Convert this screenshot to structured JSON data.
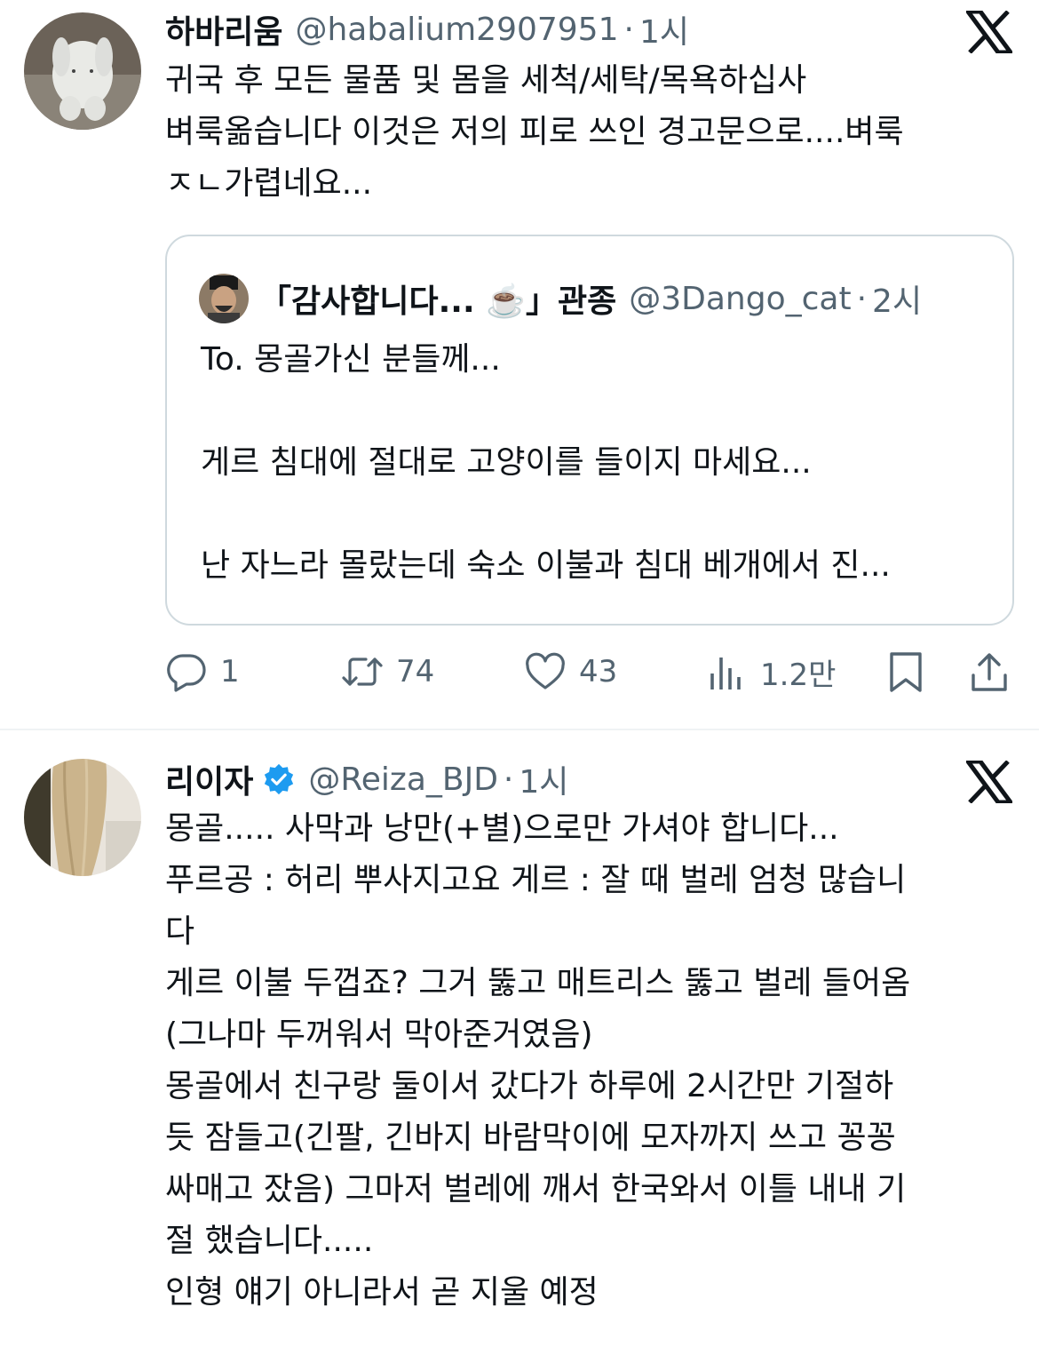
{
  "tweets": [
    {
      "display_name": "하바리움",
      "handle": "@habalium2907951",
      "separator": "·",
      "time": "1시",
      "lines": [
        "귀국 후 모든 물품 및 몸을 세척/세탁/목욕하십사",
        "벼룩옮습니다 이것은 저의 피로 쓰인 경고문으로....벼룩",
        "ㅈㄴ가렵네요..."
      ],
      "quote": {
        "display_name": "「감사합니다... ☕️」관종",
        "handle": "@3Dango_cat",
        "separator": "·",
        "time": "2시",
        "lines": [
          "To. 몽골가신 분들께...",
          "",
          "게르 침대에 절대로 고양이를 들이지 마세요...",
          "",
          "난 자느라 몰랐는데 숙소 이불과 침대 베개에서 진..."
        ]
      },
      "actions": {
        "replies": "1",
        "retweets": "74",
        "likes": "43",
        "views": "1.2만"
      }
    },
    {
      "display_name": "리이자",
      "handle": "@Reiza_BJD",
      "separator": "·",
      "time": "1시",
      "verified": true,
      "lines": [
        "몽골..... 사막과 낭만(+별)으로만 가셔야 합니다...",
        "푸르공 : 허리 뿌사지고요 게르 : 잘 때 벌레 엄청 많습니",
        "다",
        "게르 이불 두껍죠? 그거 뚫고 매트리스 뚫고 벌레 들어옴",
        "(그나마 두꺼워서 막아준거였음)",
        "몽골에서 친구랑 둘이서 갔다가 하루에 2시간만 기절하",
        "듯 잠들고(긴팔, 긴바지 바람막이에 모자까지 쓰고 꽁꽁",
        "싸매고 잤음) 그마저 벌레에 깨서 한국와서 이틀 내내 기",
        "절 했습니다.....",
        "인형 얘기 아니라서 곧 지울 예정"
      ]
    }
  ],
  "icons": {
    "reply": "reply-icon",
    "retweet": "retweet-icon",
    "like": "heart-icon",
    "views": "views-icon",
    "bookmark": "bookmark-icon",
    "share": "share-icon",
    "platform": "x-logo-icon",
    "verified": "verified-badge-icon"
  },
  "colors": {
    "text": "#0f1419",
    "secondary": "#536471",
    "border": "#cfd9de",
    "verified": "#1d9bf0"
  }
}
